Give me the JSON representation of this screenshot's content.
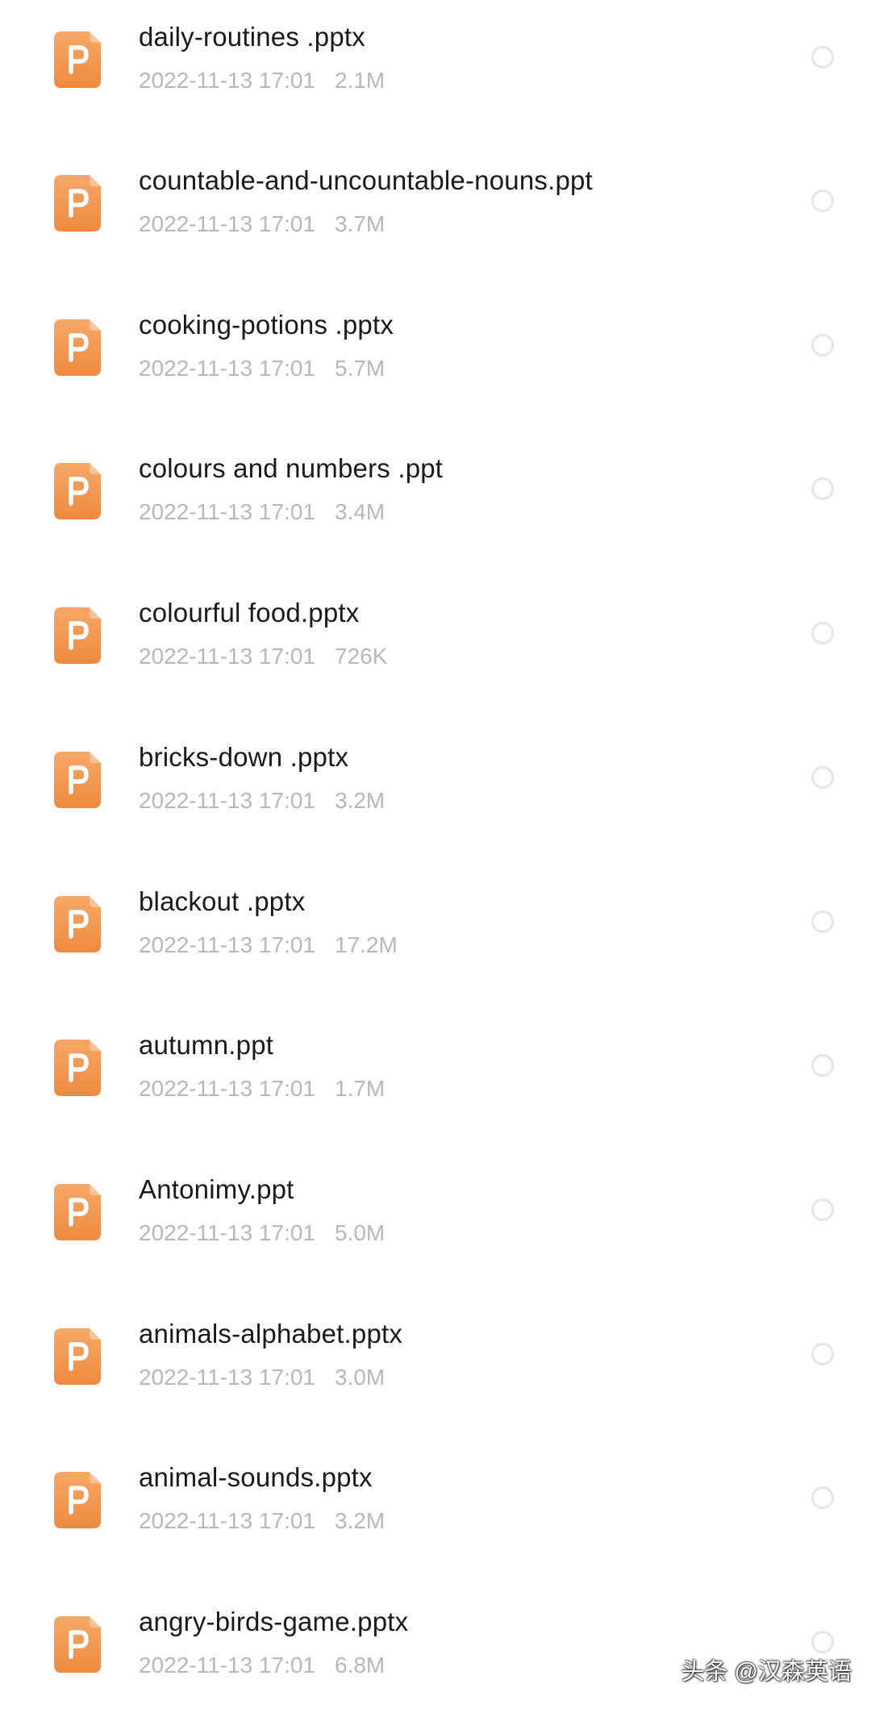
{
  "colors": {
    "icon_gradient_top": "#f6a868",
    "icon_gradient_bottom": "#ee8a3f",
    "name_text": "#1a1a1a",
    "meta_text": "#b7b7bc",
    "radio_border": "#e6e6ea"
  },
  "files": [
    {
      "name": "daily-routines .pptx",
      "date": "2022-11-13 17:01",
      "size": "2.1M",
      "icon": "ppt-file-icon"
    },
    {
      "name": "countable-and-uncountable-nouns.ppt",
      "date": "2022-11-13 17:01",
      "size": "3.7M",
      "icon": "ppt-file-icon"
    },
    {
      "name": "cooking-potions .pptx",
      "date": "2022-11-13 17:01",
      "size": "5.7M",
      "icon": "ppt-file-icon"
    },
    {
      "name": "colours and numbers .ppt",
      "date": "2022-11-13 17:01",
      "size": "3.4M",
      "icon": "ppt-file-icon"
    },
    {
      "name": "colourful food.pptx",
      "date": "2022-11-13 17:01",
      "size": "726K",
      "icon": "ppt-file-icon"
    },
    {
      "name": "bricks-down .pptx",
      "date": "2022-11-13 17:01",
      "size": "3.2M",
      "icon": "ppt-file-icon"
    },
    {
      "name": "blackout .pptx",
      "date": "2022-11-13 17:01",
      "size": "17.2M",
      "icon": "ppt-file-icon"
    },
    {
      "name": "autumn.ppt",
      "date": "2022-11-13 17:01",
      "size": "1.7M",
      "icon": "ppt-file-icon"
    },
    {
      "name": "Antonimy.ppt",
      "date": "2022-11-13 17:01",
      "size": "5.0M",
      "icon": "ppt-file-icon"
    },
    {
      "name": "animals-alphabet.pptx",
      "date": "2022-11-13 17:01",
      "size": "3.0M",
      "icon": "ppt-file-icon"
    },
    {
      "name": "animal-sounds.pptx",
      "date": "2022-11-13 17:01",
      "size": "3.2M",
      "icon": "ppt-file-icon"
    },
    {
      "name": "angry-birds-game.pptx",
      "date": "2022-11-13 17:01",
      "size": "6.8M",
      "icon": "ppt-file-icon"
    }
  ],
  "watermark": {
    "text": "头条 @汉森英语"
  }
}
